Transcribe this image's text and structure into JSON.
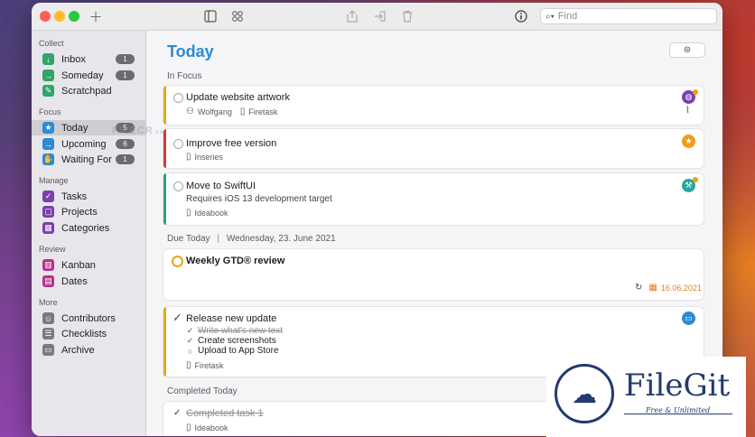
{
  "toolbar": {
    "new_icon": "plus-icon",
    "search_placeholder": "Find"
  },
  "sidebar": {
    "sections": [
      {
        "title": "Collect"
      },
      {
        "title": "Focus"
      },
      {
        "title": "Manage"
      },
      {
        "title": "Review"
      },
      {
        "title": "More"
      }
    ],
    "items": [
      {
        "label": "Inbox",
        "count": "1",
        "icon": "inbox-icon",
        "color": "#2fa56a"
      },
      {
        "label": "Someday",
        "count": "1",
        "icon": "someday-icon",
        "color": "#2fa56a"
      },
      {
        "label": "Scratchpad",
        "count": "",
        "icon": "scratchpad-icon",
        "color": "#2fa56a"
      },
      {
        "label": "Today",
        "count": "5",
        "icon": "star-icon",
        "color": "#2a8bd6"
      },
      {
        "label": "Upcoming",
        "count": "6",
        "icon": "upcoming-icon",
        "color": "#2a8bd6"
      },
      {
        "label": "Waiting For",
        "count": "1",
        "icon": "hand-icon",
        "color": "#2a8bd6"
      },
      {
        "label": "Tasks",
        "count": "",
        "icon": "tasks-icon",
        "color": "#7b3fb0"
      },
      {
        "label": "Projects",
        "count": "",
        "icon": "projects-icon",
        "color": "#7b3fb0"
      },
      {
        "label": "Categories",
        "count": "",
        "icon": "categories-icon",
        "color": "#7b3fb0"
      },
      {
        "label": "Kanban",
        "count": "",
        "icon": "kanban-icon",
        "color": "#b5318f"
      },
      {
        "label": "Dates",
        "count": "",
        "icon": "dates-icon",
        "color": "#b5318f"
      },
      {
        "label": "Contributors",
        "count": "",
        "icon": "contributors-icon",
        "color": "#7a7a80"
      },
      {
        "label": "Checklists",
        "count": "",
        "icon": "checklists-icon",
        "color": "#7a7a80"
      },
      {
        "label": "Archive",
        "count": "",
        "icon": "archive-icon",
        "color": "#7a7a80"
      }
    ]
  },
  "main": {
    "title": "Today",
    "in_focus_header": "In Focus",
    "due_header": "Due Today",
    "due_date": "Wednesday, 23. June 2021",
    "completed_header": "Completed Today",
    "tasks": [
      {
        "title": "Update website artwork",
        "contributor": "Wolfgang",
        "project": "Firetask",
        "accent": "#e6a817"
      },
      {
        "title": "Improve free version",
        "project": "Inseries",
        "accent": "#d33a3a"
      },
      {
        "title": "Move to SwiftUI",
        "note": "Requires iOS 13 development target",
        "project": "Ideabook",
        "accent": "#2fa56a"
      },
      {
        "title": "Weekly GTD® review",
        "due": "16.06.2021",
        "due_color": "#e67e22"
      },
      {
        "title": "Release new update",
        "project": "Firetask",
        "accent": "#e6a817",
        "subtasks": [
          "Write what's new text",
          "Create screenshots",
          "Upload to App Store"
        ]
      },
      {
        "title": "Completed task 1",
        "project": "Ideabook"
      }
    ]
  },
  "watermark": {
    "text": "FILECR",
    "suffix": ".com"
  },
  "logo": {
    "name": "FileGit",
    "tagline": "Free & Unlimited"
  }
}
